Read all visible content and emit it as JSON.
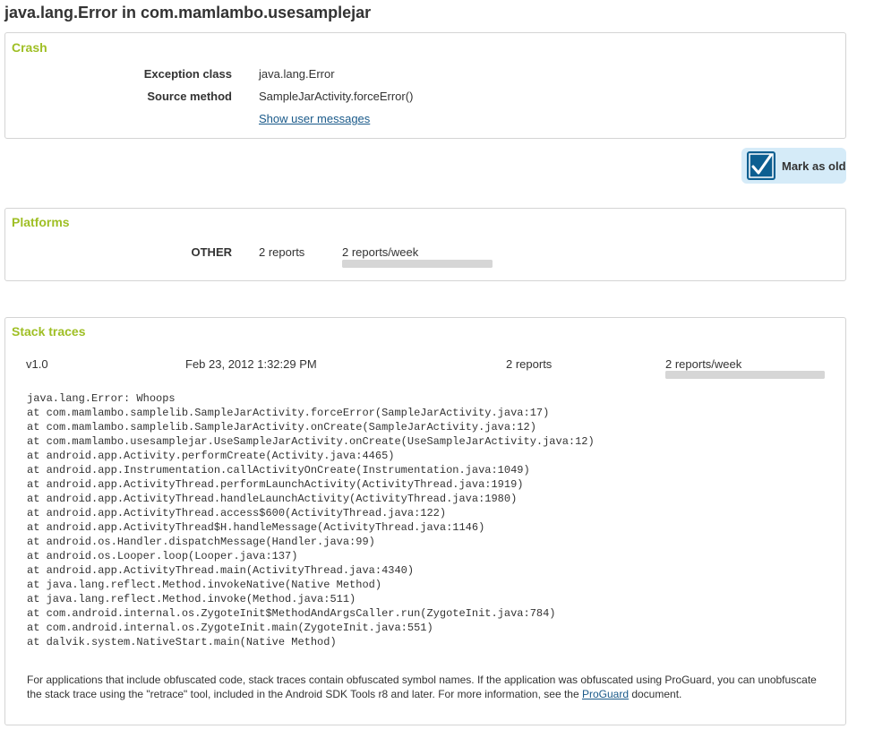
{
  "page": {
    "title": "java.lang.Error in com.mamlambo.usesamplejar"
  },
  "crash": {
    "title": "Crash",
    "exception_class_label": "Exception class",
    "exception_class_value": "java.lang.Error",
    "source_method_label": "Source method",
    "source_method_value": "SampleJarActivity.forceError()",
    "show_messages_link": "Show user messages"
  },
  "mark_old": {
    "label": "Mark as old",
    "checked": true
  },
  "platforms": {
    "title": "Platforms",
    "rows": [
      {
        "name": "OTHER",
        "reports": "2 reports",
        "rate": "2 reports/week",
        "rate_fraction": 1.0
      }
    ]
  },
  "stack_traces": {
    "title": "Stack traces",
    "entries": [
      {
        "version": "v1.0",
        "date": "Feb 23, 2012 1:32:29 PM",
        "reports": "2 reports",
        "rate": "2 reports/week",
        "rate_fraction": 1.0,
        "lines": [
          "java.lang.Error: Whoops",
          "at com.mamlambo.samplelib.SampleJarActivity.forceError(SampleJarActivity.java:17)",
          "at com.mamlambo.samplelib.SampleJarActivity.onCreate(SampleJarActivity.java:12)",
          "at com.mamlambo.usesamplejar.UseSampleJarActivity.onCreate(UseSampleJarActivity.java:12)",
          "at android.app.Activity.performCreate(Activity.java:4465)",
          "at android.app.Instrumentation.callActivityOnCreate(Instrumentation.java:1049)",
          "at android.app.ActivityThread.performLaunchActivity(ActivityThread.java:1919)",
          "at android.app.ActivityThread.handleLaunchActivity(ActivityThread.java:1980)",
          "at android.app.ActivityThread.access$600(ActivityThread.java:122)",
          "at android.app.ActivityThread$H.handleMessage(ActivityThread.java:1146)",
          "at android.os.Handler.dispatchMessage(Handler.java:99)",
          "at android.os.Looper.loop(Looper.java:137)",
          "at android.app.ActivityThread.main(ActivityThread.java:4340)",
          "at java.lang.reflect.Method.invokeNative(Native Method)",
          "at java.lang.reflect.Method.invoke(Method.java:511)",
          "at com.android.internal.os.ZygoteInit$MethodAndArgsCaller.run(ZygoteInit.java:784)",
          "at com.android.internal.os.ZygoteInit.main(ZygoteInit.java:551)",
          "at dalvik.system.NativeStart.main(Native Method)"
        ]
      }
    ],
    "note_before_link": "For applications that include obfuscated code, stack traces contain obfuscated symbol names. If the application was obfuscated using ProGuard, you can unobfuscate the stack trace using the \"retrace\" tool, included in the Android SDK Tools r8 and later. For more information, see the ",
    "note_link": "ProGuard",
    "note_after_link": " document."
  },
  "colors": {
    "section_title": "#9fbf25",
    "link": "#1a5a8a",
    "mark_old_bg": "#d5ebf8",
    "checkbox": "#0d5f91",
    "bar": "#d6d6d6"
  }
}
